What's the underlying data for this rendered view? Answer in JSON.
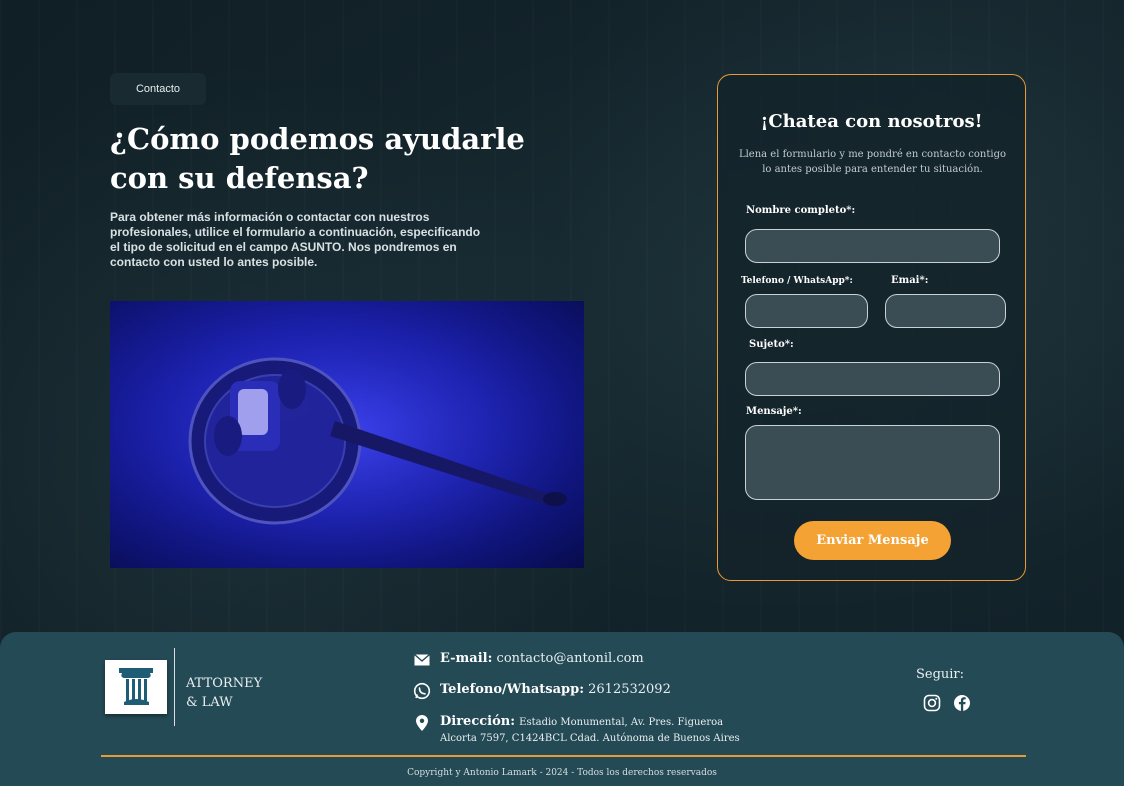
{
  "hero": {
    "tag": "Contacto",
    "title": "¿Cómo podemos ayudarle con su defensa?",
    "description": "Para obtener más información o contactar con nuestros profesionales, utilice el formulario a continuación, especificando el tipo de solicitud en el campo ASUNTO. Nos pondremos en contacto con usted lo antes posible."
  },
  "form": {
    "title": "¡Chatea con nosotros!",
    "subtitle": "Llena el formulario y me pondré en contacto contigo lo antes posible para entender tu situación.",
    "name_label": "Nombre completo*:",
    "name_value": "",
    "phone_label": "Telefono / WhatsApp*:",
    "phone_value": "",
    "email_label": "Emai*:",
    "email_value": "",
    "subject_label": "Sujeto*:",
    "subject_value": "",
    "message_label": "Mensaje*:",
    "message_value": "",
    "submit_label": "Enviar Mensaje"
  },
  "footer": {
    "brand_line1": "ATTORNEY",
    "brand_line2": "& LAW",
    "email_label": "E-mail:",
    "email_value": "contacto@antonil.com",
    "phone_label": "Telefono/Whatsapp:",
    "phone_value": "2612532092",
    "address_label": "Dirección:",
    "address_line1": "Estadio Monumental, Av. Pres. Figueroa",
    "address_line2": "Alcorta 7597, C1424BCL Cdad. Autónoma de Buenos Aires",
    "follow_label": "Seguir:",
    "copyright": "Copyright y Antonio Lamark - 2024 - Todos los derechos reservados"
  },
  "colors": {
    "accent": "#f3a233",
    "footer_bg": "#244a55",
    "page_bg": "#13232a"
  },
  "icons": [
    "gavel-image",
    "pillar-logo-icon",
    "mail-icon",
    "whatsapp-icon",
    "location-pin-icon",
    "instagram-icon",
    "facebook-icon"
  ]
}
